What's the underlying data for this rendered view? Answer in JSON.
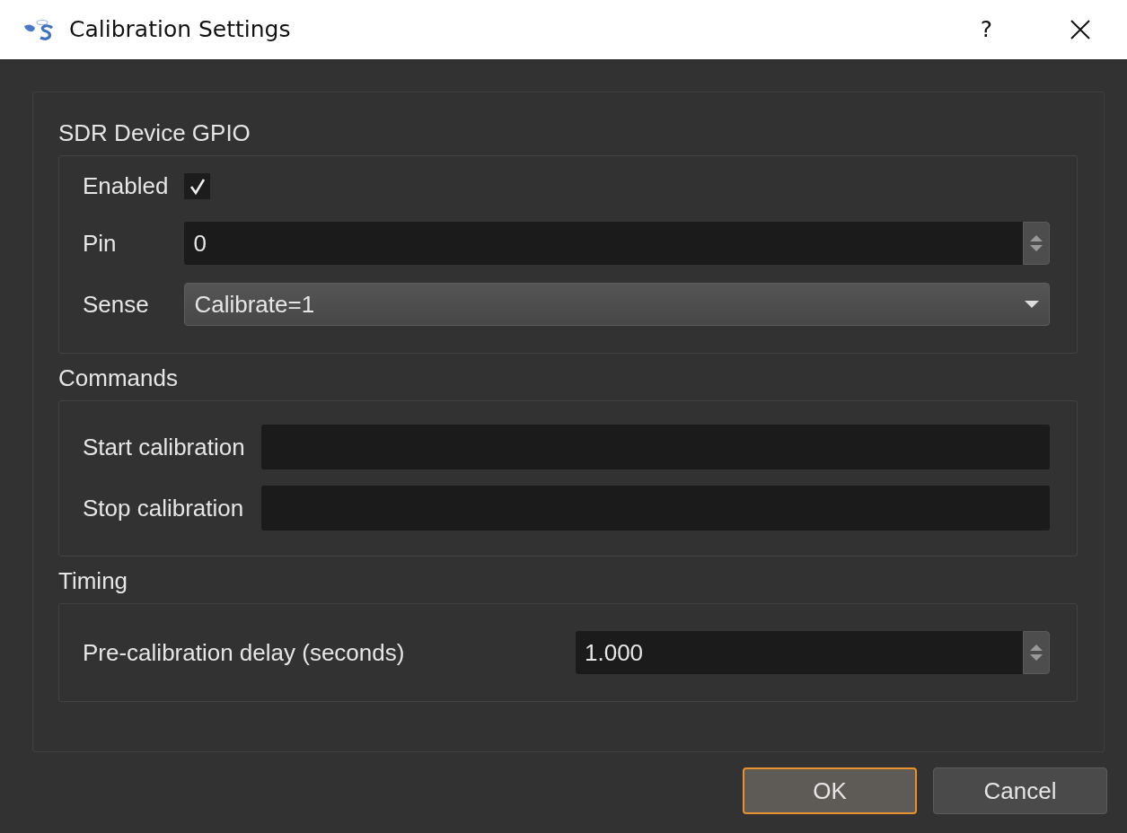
{
  "window": {
    "title": "Calibration Settings",
    "help": "?"
  },
  "sections": [
    {
      "title": "SDR Device GPIO",
      "rows": [
        {
          "kind": "checkbox",
          "label": "Enabled",
          "checked": true
        },
        {
          "kind": "spinbox",
          "label": "Pin",
          "value": "0"
        },
        {
          "kind": "combo",
          "label": "Sense",
          "value": "Calibrate=1"
        }
      ]
    },
    {
      "title": "Commands",
      "rows": [
        {
          "kind": "text",
          "label": "Start calibration"
        },
        {
          "kind": "text",
          "label": "Stop calibration"
        }
      ]
    },
    {
      "title": "Timing",
      "rows": [
        {
          "kind": "spinbox",
          "label": "Pre-calibration delay (seconds)",
          "value": "1.000"
        }
      ]
    }
  ],
  "buttons": [
    {
      "label": "OK",
      "default": true
    },
    {
      "label": "Cancel",
      "default": false
    }
  ]
}
